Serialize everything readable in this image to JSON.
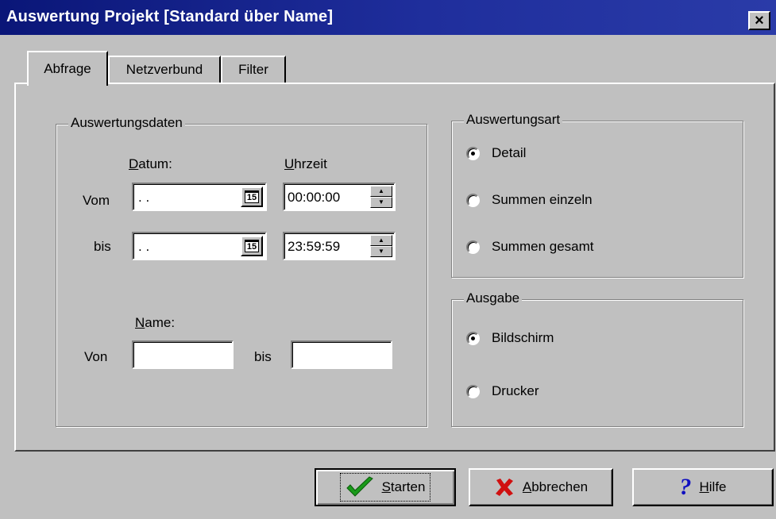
{
  "window": {
    "title": "Auswertung Projekt [Standard über Name]",
    "close_symbol": "×"
  },
  "tabs": [
    {
      "label": "Abfrage",
      "active": true
    },
    {
      "label": "Netzverbund",
      "active": false
    },
    {
      "label": "Filter",
      "active": false
    }
  ],
  "auswertungsdaten": {
    "legend": "Auswertungsdaten",
    "datum_header": "Datum:",
    "uhrzeit_header": "Uhrzeit",
    "vom_label": "Vom",
    "bis_label": "bis",
    "vom_datum": ". .",
    "bis_datum": ". .",
    "calendar_icon_text": "15",
    "vom_uhrzeit": "00:00:00",
    "bis_uhrzeit": "23:59:59",
    "name_header": "Name:",
    "name_von_label": "Von",
    "name_bis_label": "bis",
    "name_von_value": "",
    "name_bis_value": ""
  },
  "auswertungsart": {
    "legend": "Auswertungsart",
    "options": [
      {
        "label": "Detail",
        "selected": true
      },
      {
        "label": "Summen einzeln",
        "selected": false
      },
      {
        "label": "Summen gesamt",
        "selected": false
      }
    ]
  },
  "ausgabe": {
    "legend": "Ausgabe",
    "options": [
      {
        "label": "Bildschirm",
        "selected": true
      },
      {
        "label": "Drucker",
        "selected": false
      }
    ]
  },
  "buttons": {
    "starten": "Starten",
    "abbrechen": "Abbrechen",
    "hilfe": "Hilfe"
  },
  "colors": {
    "titlebar": "#0a1678",
    "face": "#c0c0c0",
    "check_icon": "#1a9a1a",
    "cancel_icon": "#d01010",
    "help_icon": "#1010c0"
  }
}
